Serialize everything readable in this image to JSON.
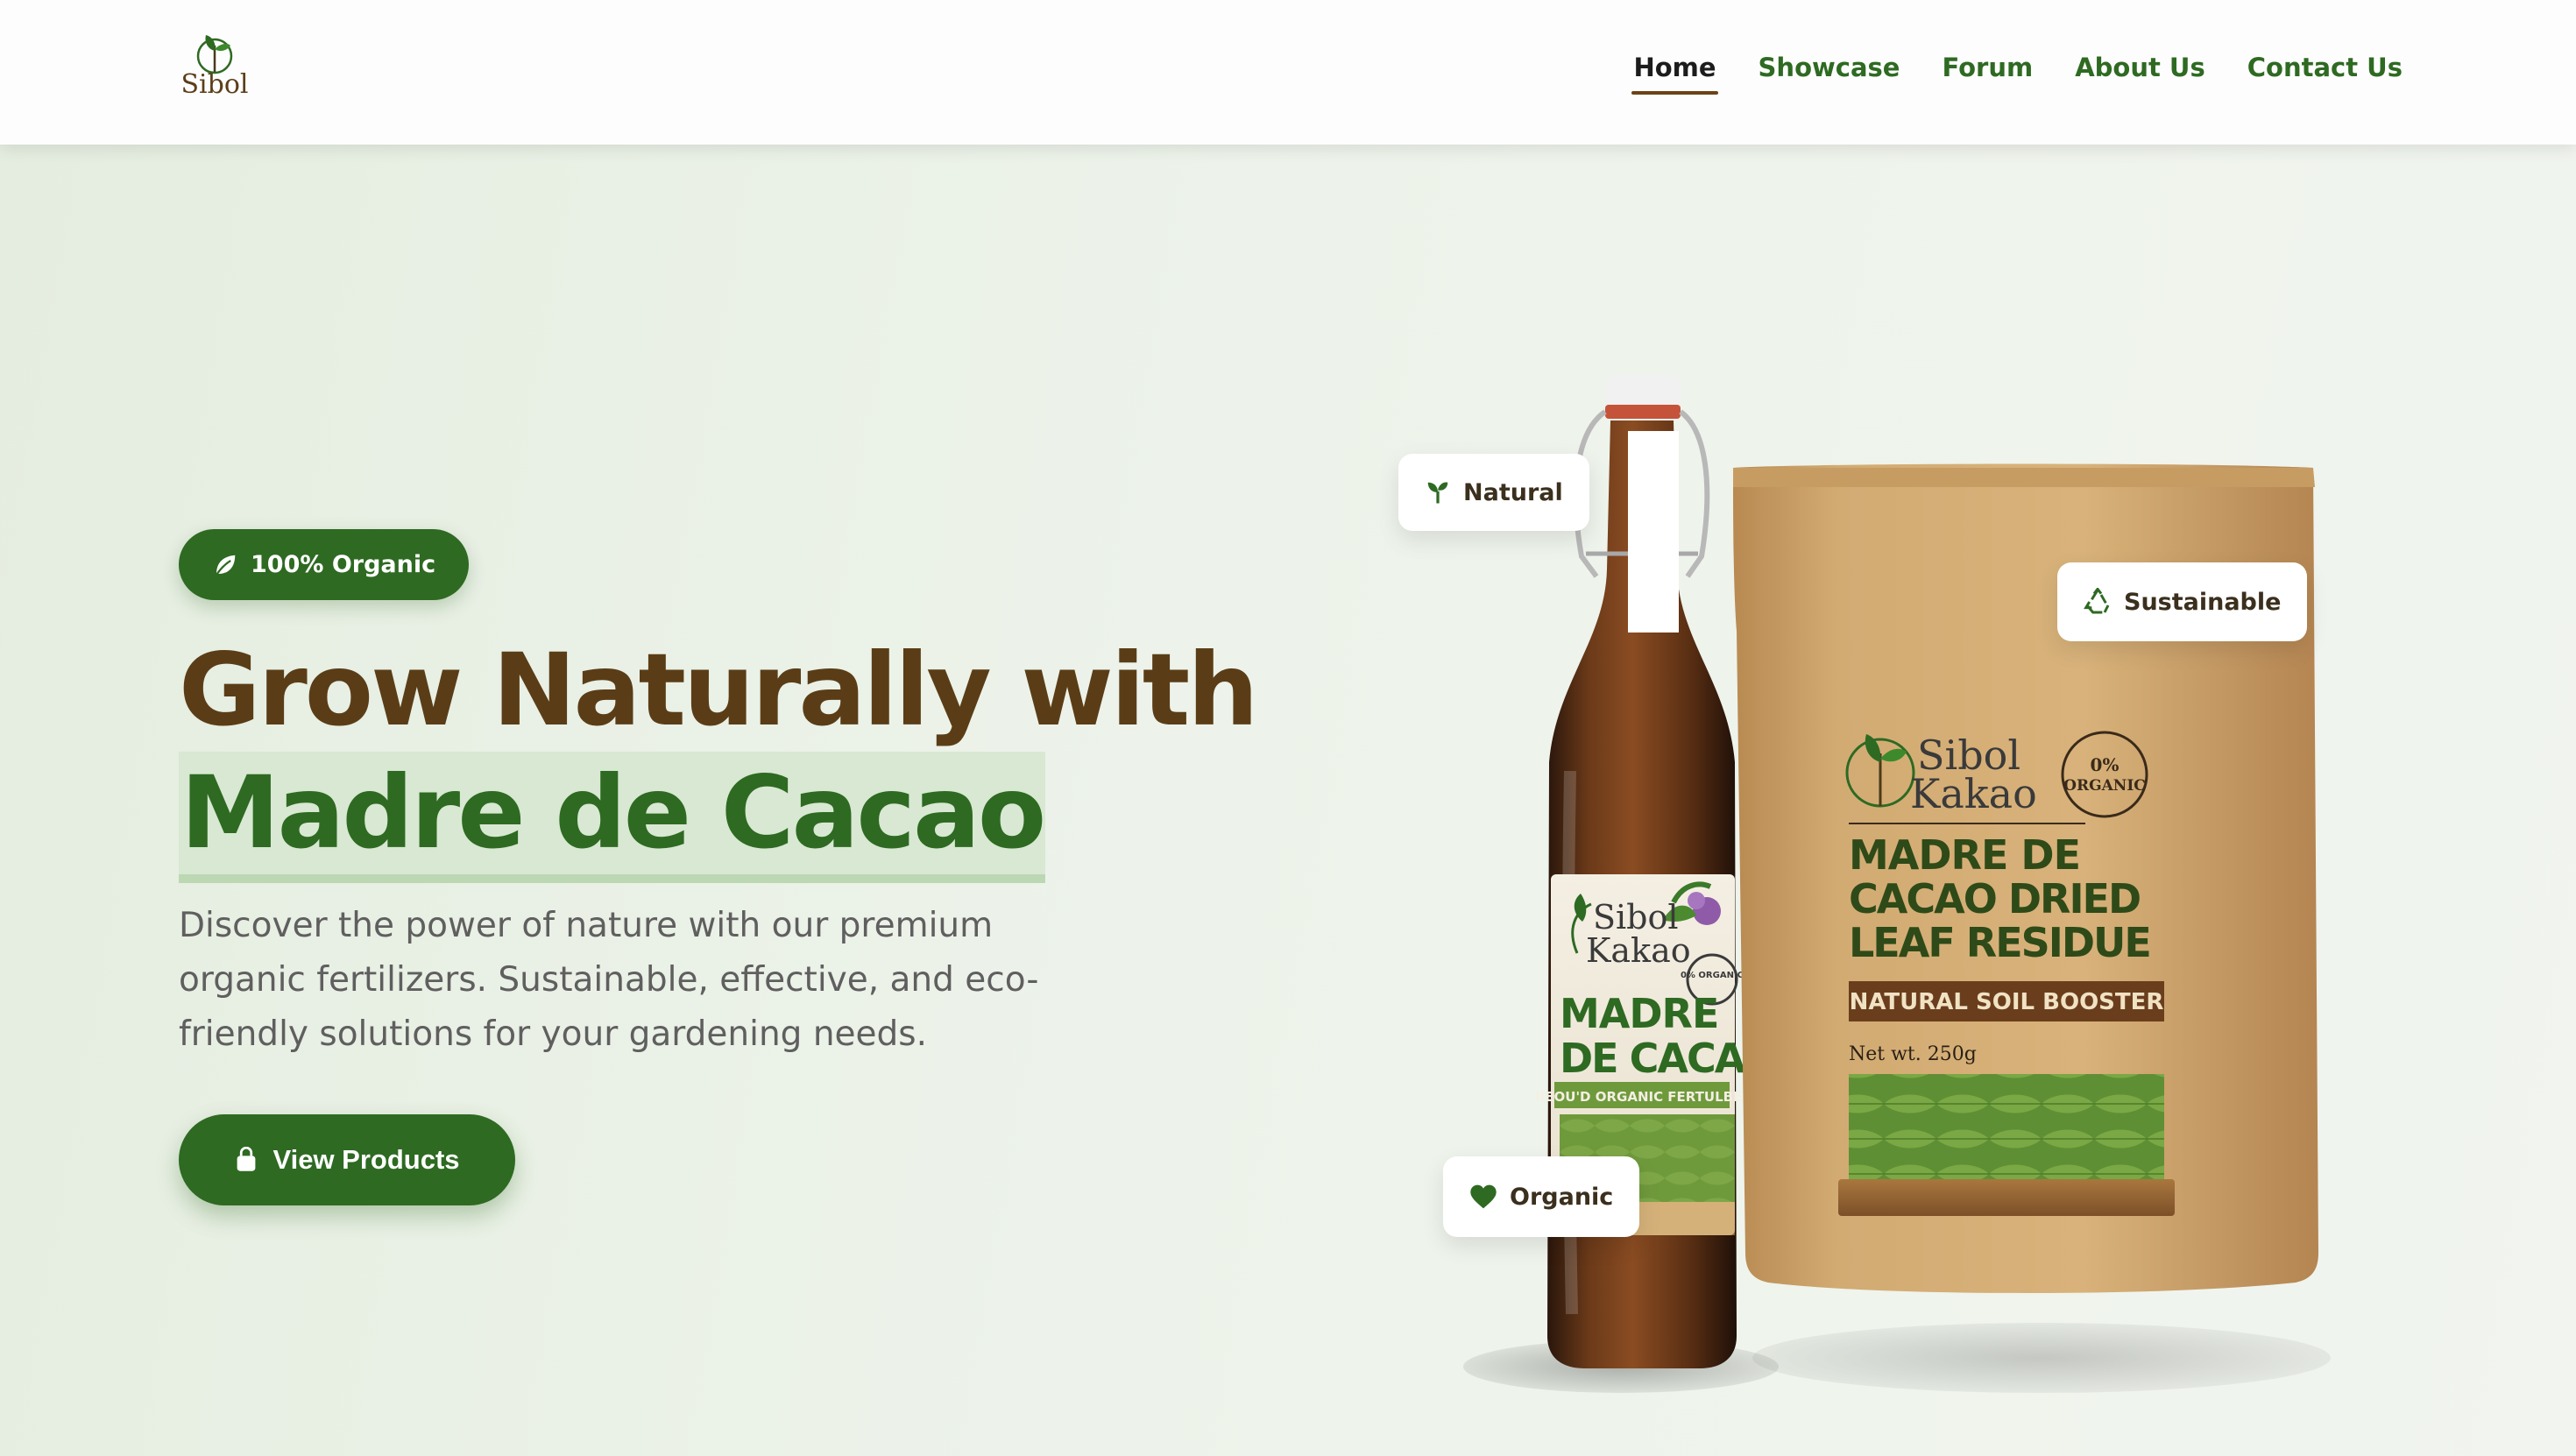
{
  "nav": {
    "logo_text": "Sibol",
    "links": [
      {
        "label": "Home",
        "active": true
      },
      {
        "label": "Showcase",
        "active": false
      },
      {
        "label": "Forum",
        "active": false
      },
      {
        "label": "About Us",
        "active": false
      },
      {
        "label": "Contact Us",
        "active": false
      }
    ]
  },
  "hero": {
    "badge_label": "100% Organic",
    "badge_icon": "leaf-icon",
    "title_line1": "Grow Naturally with",
    "title_line2": "Madre de Cacao",
    "description": "Discover the power of nature with our premium organic fertilizers. Sustainable, effective, and eco-friendly solutions for your gardening needs.",
    "cta_label": "View Products",
    "cta_icon": "shopping-bag-icon"
  },
  "product_tags": {
    "natural": "Natural",
    "sustainable": "Sustainable",
    "organic": "Organic"
  },
  "bottle": {
    "brand_line1": "Sibol",
    "brand_line2": "Kakao",
    "seal": "0% ORGANIC",
    "name_line1": "MADRE",
    "name_line2": "DE CACAO",
    "subtitle": "IIEOU'D ORGANIC FERTULBER"
  },
  "pouch": {
    "brand_line1": "Sibol",
    "brand_line2": "Kakao",
    "seal_line1": "0%",
    "seal_line2": "ORGANIC",
    "name_line1": "MADRE DE",
    "name_line2": "CACAO DRIED",
    "name_line3": "LEAF RESIDUE",
    "banner": "NATURAL SOIL BOOSTER",
    "net_weight": "Net wt. 250g"
  },
  "colors": {
    "primary_green": "#2e6a22",
    "brown": "#5a3d17",
    "kraft": "#c9a066",
    "text_gray": "#5f5f5f"
  }
}
